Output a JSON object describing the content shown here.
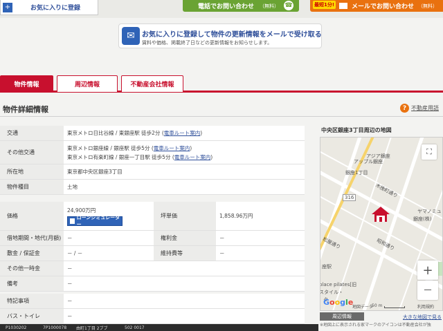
{
  "header": {
    "favorite_label": "お気に入りに登録",
    "favorite_plus": "+",
    "phone_label": "電話でお問い合わせ",
    "phone_note": "（無料）",
    "mail_badge": "最短1分!",
    "mail_label": "メールでお問い合わせ",
    "mail_note": "（無料）"
  },
  "promo": {
    "title": "お気に入りに登録して物件の更新情報をメールで受け取る",
    "subtitle": "賃料や価格、掲載終了日などの更新情報をお知らせします。"
  },
  "tabs": [
    {
      "label": "物件情報",
      "active": true
    },
    {
      "label": "周辺情報",
      "active": false
    },
    {
      "label": "不動産会社情報",
      "active": false
    }
  ],
  "section_title": "物件詳細情報",
  "help_label": "不動産用語",
  "details": [
    {
      "label": "交通",
      "lines": [
        {
          "text": "東京メトロ日比谷線 / 東銀座駅 徒歩2分",
          "link": "電車ルート案内"
        }
      ]
    },
    {
      "label": "その他交通",
      "lines": [
        {
          "text": "東京メトロ銀座線 / 銀座駅 徒歩5分",
          "link": "電車ルート案内"
        },
        {
          "text": "東京メトロ有楽町線 / 銀座一丁目駅 徒歩5分",
          "link": "電車ルート案内"
        }
      ]
    },
    {
      "label": "所在地",
      "lines": [
        {
          "text": "東京都中央区銀座3丁目",
          "link": ""
        }
      ]
    },
    {
      "label": "物件種目",
      "lines": [
        {
          "text": "土地",
          "link": ""
        }
      ]
    }
  ],
  "price": {
    "price_label": "価格",
    "price_value": "24,900万円",
    "loan_button": "ローンシミュレーター",
    "tsubo_label": "坪単価",
    "tsubo_value": "1,858.96万円"
  },
  "price_rows": [
    {
      "l1": "借地期間・地代(月額)",
      "v1": "－",
      "l2": "権利金",
      "v2": "－"
    },
    {
      "l1": "敷金 / 保証金",
      "v1": "－ / －",
      "l2": "維持費等",
      "v2": "－"
    },
    {
      "l1": "その他一時金",
      "v1": "－",
      "l2": "",
      "v2": ""
    },
    {
      "l1": "備考",
      "v1": "－",
      "l2": "",
      "v2": ""
    }
  ],
  "extra_rows": [
    {
      "label": "特記事項",
      "value": "－"
    },
    {
      "label": "バス・トイレ",
      "value": "－"
    }
  ],
  "map": {
    "title": "中央区銀座3丁目周辺の地図",
    "labels": [
      "アップル銀座",
      "アジア銀座",
      "銀座1丁目",
      "316",
      "木挽町通り",
      "ヤマノミュ",
      "銀座(株)",
      "松屋通り",
      "座駅",
      "place pilates[旧",
      "スタイル・",
      "タ",
      "昭和通り"
    ],
    "google": "Google",
    "map_data": "地図データ",
    "scale": "50 m",
    "terms": "利用規約",
    "zoom_in": "+",
    "zoom_out": "－",
    "fullscreen": "⛶"
  },
  "below_map": {
    "nearby_button": "周辺情報",
    "big_map_link": "大きな地図で見る",
    "note": "※地図上に表示される家マークのアイコンは不動産会社が独"
  },
  "status_bar": [
    "P1030202",
    "7P1000078",
    "由町1丁目 2ブブ",
    "502 0017"
  ],
  "colors": {
    "accent": "#c8102e",
    "brand_blue": "#2f63b7",
    "phone_green": "#6aa333",
    "mail_orange": "#e9710f"
  }
}
